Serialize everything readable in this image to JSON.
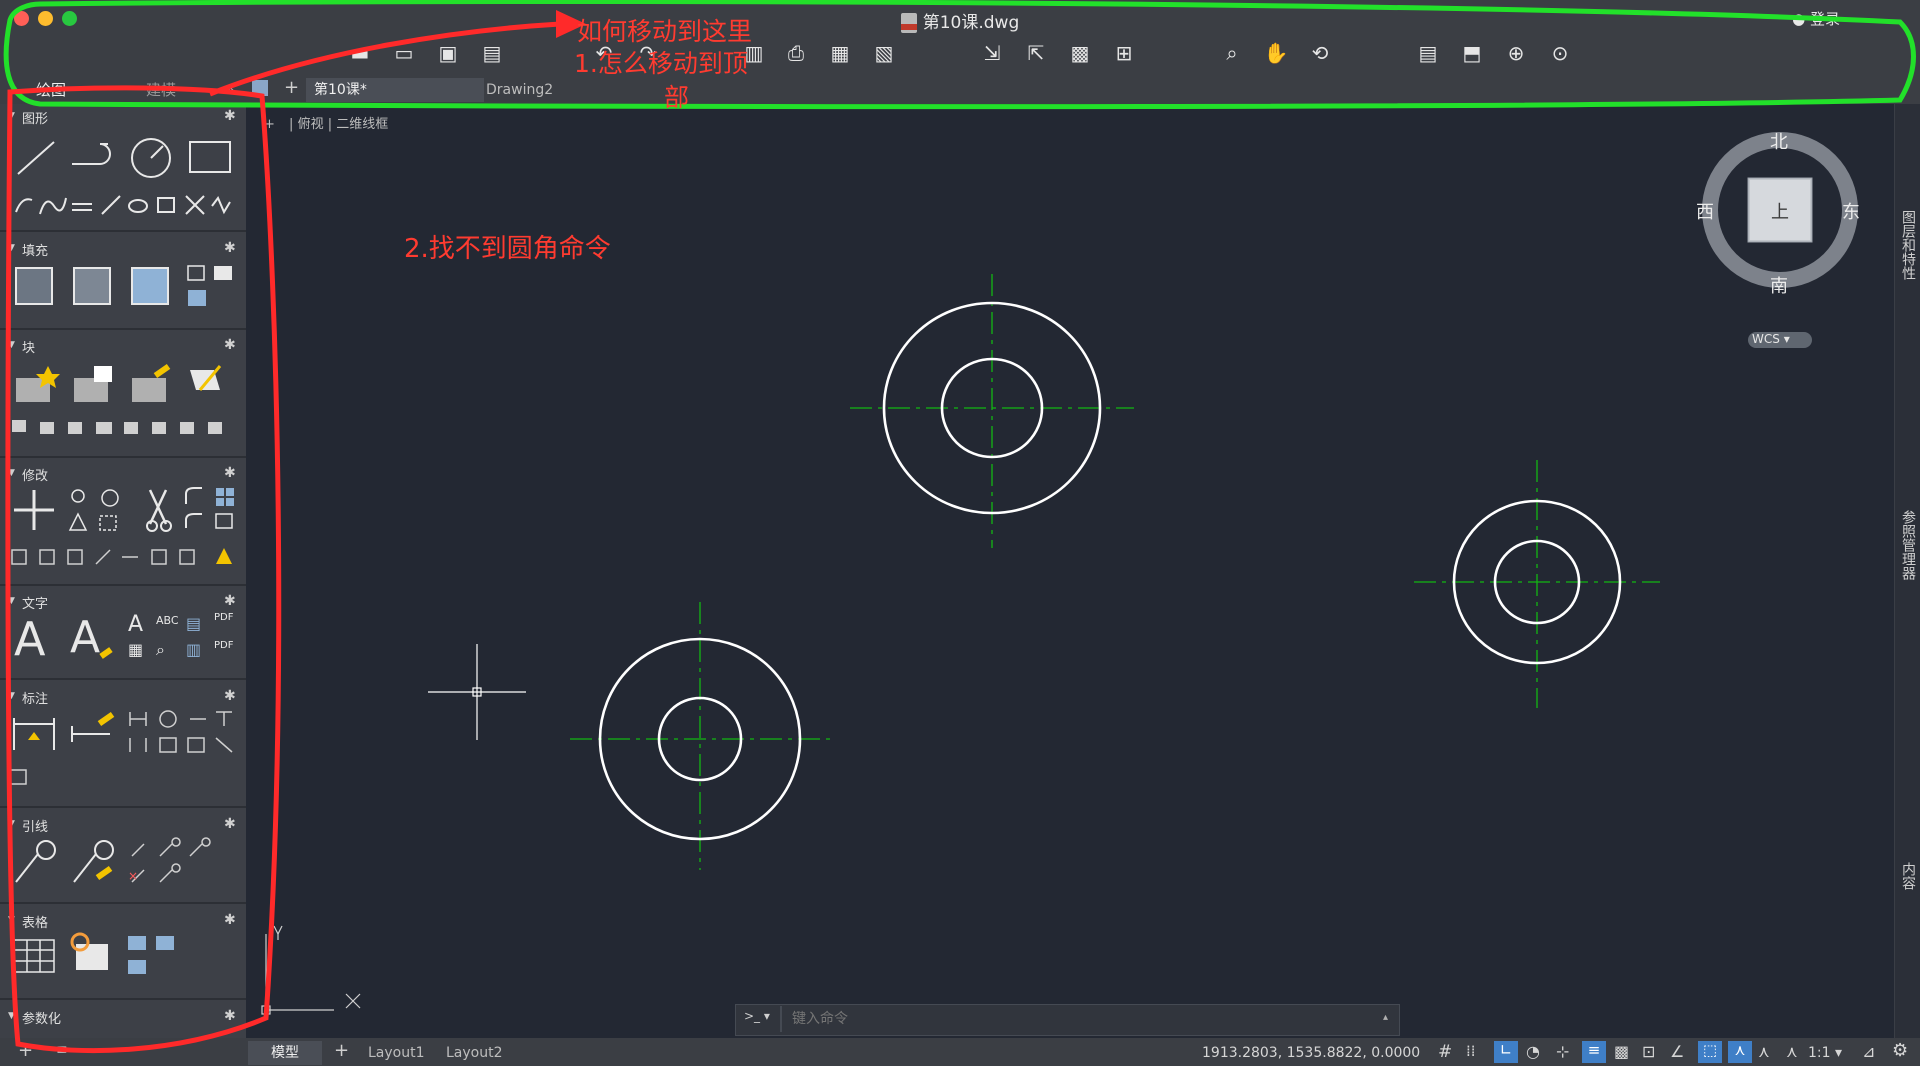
{
  "window": {
    "title": "第10课.dwg",
    "login": "登录"
  },
  "annotations": {
    "top_note_1": "如何移动到这里",
    "top_note_2": "1.怎么移动到顶",
    "top_note_3": "部",
    "canvas_note": "2.找不到圆角命令"
  },
  "palette_tabs": {
    "draw": "绘图",
    "model": "建模"
  },
  "doc_tabs": {
    "active": "第10课*",
    "other": "Drawing2"
  },
  "sections": {
    "shapes": "图形",
    "fill": "填充",
    "block": "块",
    "modify": "修改",
    "text": "文字",
    "dimension": "标注",
    "leader": "引线",
    "table": "表格",
    "parametric": "参数化"
  },
  "viewport": {
    "plus": "+",
    "view": "俯视",
    "style": "二维线框"
  },
  "viewcube": {
    "north": "北",
    "south": "南",
    "east": "东",
    "west": "西",
    "top": "上",
    "wcs": "WCS"
  },
  "right_panels": {
    "layers": "图层和特性",
    "xref": "参照管理器",
    "content": "内容"
  },
  "command": {
    "prompt": ">_",
    "placeholder": "键入命令"
  },
  "status": {
    "model": "模型",
    "layout1": "Layout1",
    "layout2": "Layout2",
    "coords": "1913.2803, 1535.8822, 0.0000",
    "scale": "1:1"
  },
  "colors": {
    "canvas_bg": "#232833",
    "panel_bg": "#3d4047",
    "annotation_red": "#ff3b30",
    "annotation_green": "#22e02a",
    "centerline_green": "#13b613"
  }
}
